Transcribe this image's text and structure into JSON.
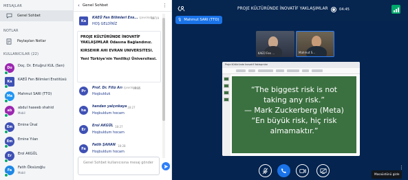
{
  "sidebar": {
    "messages_title": "MESAJLAR",
    "public_chat_label": "Genel Sohbet",
    "notes_title": "NOTLAR",
    "shared_notes_label": "Paylaşılan Notlar",
    "users_title": "KULLANICILAR (22)",
    "users": [
      {
        "initials": "Do",
        "name": "Doç. Dr. Ertuğrul KUL (Sen)",
        "sub": "",
        "color": "#9c27b0"
      },
      {
        "initials": "Ka",
        "name": "KAEÜ Fen Bilimleri Enstitüsü",
        "sub": "",
        "color": "#3f51b5"
      },
      {
        "initials": "Ma",
        "name": "Mahmut SARI (TTO)",
        "sub": "",
        "color": "#2196f3"
      },
      {
        "initials": "ab",
        "name": "abdul haseeb shahid",
        "sub": "Mobil",
        "color": "#9c27b0"
      },
      {
        "initials": "Em",
        "name": "Emine Ünal",
        "sub": "",
        "color": "#3f51b5"
      },
      {
        "initials": "Em",
        "name": "Emine Yılan",
        "sub": "",
        "color": "#3f51b5"
      },
      {
        "initials": "Er",
        "name": "Erol AKGÜL",
        "sub": "",
        "color": "#3f51b5"
      },
      {
        "initials": "Fa",
        "name": "Fatih Öksüzoğlu",
        "sub": "Mobil",
        "color": "#1e88e5"
      }
    ]
  },
  "chat": {
    "header_title": "Genel Sohbet",
    "back_icon": "chevron-left-icon",
    "first_message": {
      "initials": "Ka",
      "name": "KAEÜ Fen Bilimleri Ens...",
      "tag": "(çevrimdışı)",
      "time": "18:19",
      "text": "HOŞ GELDİNİZ",
      "color": "#3f51b5"
    },
    "welcome_lines": [
      "PROJE KÜLTÜRÜNDE İNOVATİF",
      "YAKLAŞIMLAR Odasına Bağlandınız.",
      "KIRSEHIR AHI EVRAN UNIVERSITESI.",
      "Yeni Türkiye'nin Yenilikçi Üniversitesi."
    ],
    "messages": [
      {
        "initials": "Pr",
        "name": "Prof. Dr. Filiz Arı",
        "tag": "(çevrimdışı)",
        "time": "18:26",
        "text": "Hoşbulduk",
        "color": "#3f51b5"
      },
      {
        "initials": "ha",
        "name": "handan yalçınkaya",
        "tag": "",
        "time": "18:27",
        "text": "Hoşbuldum hocam",
        "color": "#3f51b5"
      },
      {
        "initials": "Er",
        "name": "Erol AKGÜL",
        "tag": "",
        "time": "18:27",
        "text": "Hoşbuldum hocam",
        "color": "#3f51b5"
      },
      {
        "initials": "Fa",
        "name": "Fatih ŞAHAN",
        "tag": "",
        "time": "18:28",
        "text": "Hoşbuldum hocam",
        "color": "#3f51b5"
      }
    ],
    "input_placeholder": "Genel Sohbet kullanıcısına mesaj gönder"
  },
  "main": {
    "meeting_title": "PROJE KÜLTÜRÜNDE İNOVATİF YAKLAŞIMLAR",
    "recording_time": "04:45",
    "speaker": "Mahmut SARI (TTO)",
    "cameras": [
      {
        "label": "KAEÜ Fen ..."
      },
      {
        "label": "Mahmut S..."
      }
    ],
    "screen_title": "Proje Kültüründe İnovatif Yaklaşımlar",
    "slide_quote_lines": [
      "“The biggest risk is not",
      "taking any risk.”",
      "— Mark Zuckerberg (Meta)",
      "“En büyük risk, hiç risk",
      "almamaktır.”"
    ],
    "tooltip": "Masaüstünü gizle",
    "accent_color": "#1a73e8",
    "background_color": "#05244f",
    "slide_color": "#3b7140"
  }
}
